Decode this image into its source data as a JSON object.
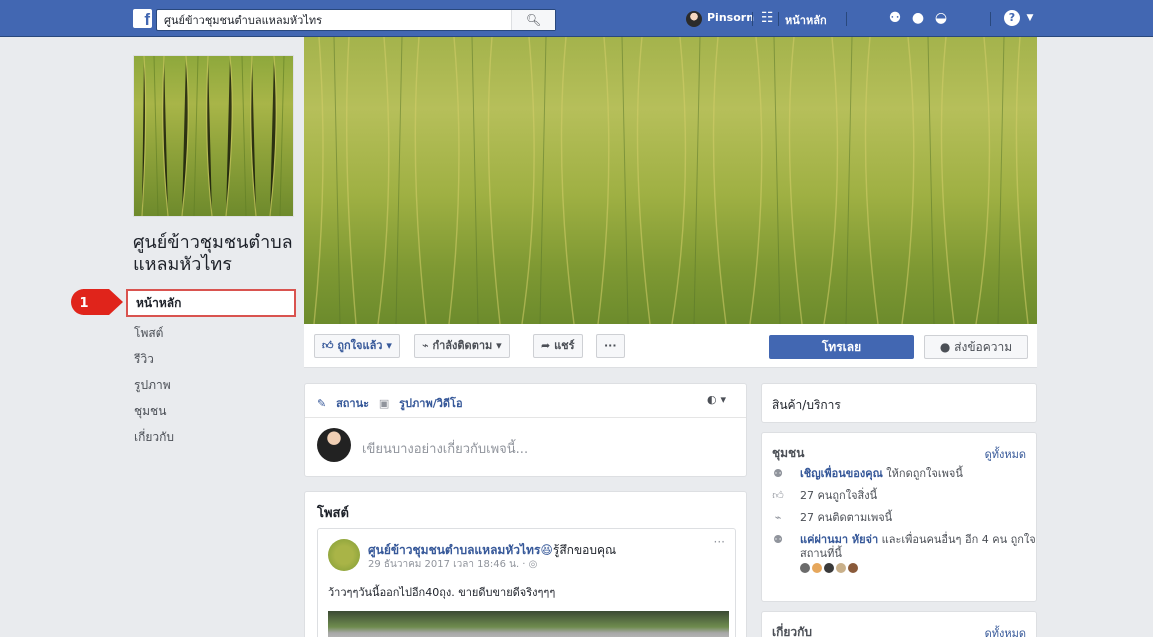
{
  "topbar": {
    "logo_letter": "f",
    "search_value": "ศูนย์ข้าวชุมชนตำบลแหลมหัวไทร",
    "search_icon": "search-icon",
    "user_name": "Pinsorn",
    "home_label": "หน้าหลัก",
    "help_glyph": "?"
  },
  "page": {
    "name": "ศูนย์ข้าวชุมชนตำบลแหลมหัวไทร"
  },
  "left_nav": {
    "items": [
      {
        "label": "หน้าหลัก"
      },
      {
        "label": "โพสต์"
      },
      {
        "label": "รีวิว"
      },
      {
        "label": "รูปภาพ"
      },
      {
        "label": "ชุมชน"
      },
      {
        "label": "เกี่ยวกับ"
      }
    ]
  },
  "callout": {
    "number": "1",
    "color": "#e0241b"
  },
  "actions": {
    "like": "ถูกใจแล้ว ▾",
    "follow": "กำลังติดตาม ▾",
    "share": "แชร์",
    "more": "···",
    "call": "โทรเลย",
    "message": "ส่งข้อความ"
  },
  "composer": {
    "status_tab": "สถานะ",
    "photo_tab": "รูปภาพ/วิดีโอ",
    "placeholder": "เขียนบางอย่างเกี่ยวกับเพจนี้..."
  },
  "posts": {
    "title": "โพสต์",
    "first": {
      "author": "ศูนย์ข้าวชุมชนตำบลแหลมหัวไทร",
      "feeling": "รู้สึกขอบคุณ",
      "time": "29 ธันวาคม 2017 เวลา 18:46 น. · ◎",
      "more": "···",
      "text": "ว้าวๆๆวันนี้ออกไปอีก40ถุง. ขายดีบขายดีจริงๆๆๆ"
    }
  },
  "right": {
    "products_title": "สินค้า/บริการ",
    "community": {
      "title": "ชุมชน",
      "see_all": "ดูทั้งหมด",
      "invite_link": "เชิญเพื่อนของคุณ",
      "invite_rest": "ให้กดถูกใจเพจนี้",
      "likes": "27 คนถูกใจสิ่งนี้",
      "follows": "27 คนติดตามเพจนี้",
      "visitors_link": "แค่ผ่านมา หัยจ่า",
      "visitors_rest": "และเพื่อนคนอื่นๆ อีก 4 คน ถูกใจสถานที่นี้"
    },
    "about": {
      "title": "เกี่ยวกับ",
      "see_all": "ดูทั้งหมด"
    }
  },
  "colors": {
    "fb_blue": "#4267b2",
    "link": "#365899",
    "highlight_border": "#d9534f"
  }
}
